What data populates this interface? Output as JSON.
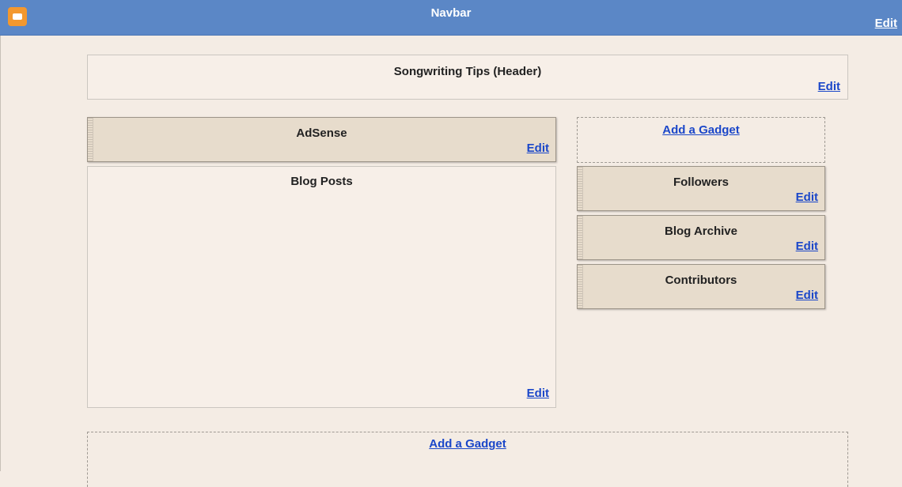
{
  "navbar": {
    "title": "Navbar",
    "edit_label": "Edit"
  },
  "header_section": {
    "title": "Songwriting Tips (Header)",
    "edit_label": "Edit"
  },
  "main": {
    "adsense": {
      "title": "AdSense",
      "edit_label": "Edit"
    },
    "blog_posts": {
      "title": "Blog Posts",
      "edit_label": "Edit"
    }
  },
  "sidebar": {
    "add_gadget_label": "Add a Gadget",
    "gadgets": [
      {
        "title": "Followers",
        "edit_label": "Edit"
      },
      {
        "title": "Blog Archive",
        "edit_label": "Edit"
      },
      {
        "title": "Contributors",
        "edit_label": "Edit"
      }
    ]
  },
  "footer": {
    "add_gadget_label": "Add a Gadget"
  },
  "icons": {
    "logo": "blogger-logo-icon"
  },
  "colors": {
    "navbar_bg": "#5b87c6",
    "link": "#1b47c9",
    "page_bg": "#f4ece4",
    "gadget_bg": "#e7dccc"
  }
}
